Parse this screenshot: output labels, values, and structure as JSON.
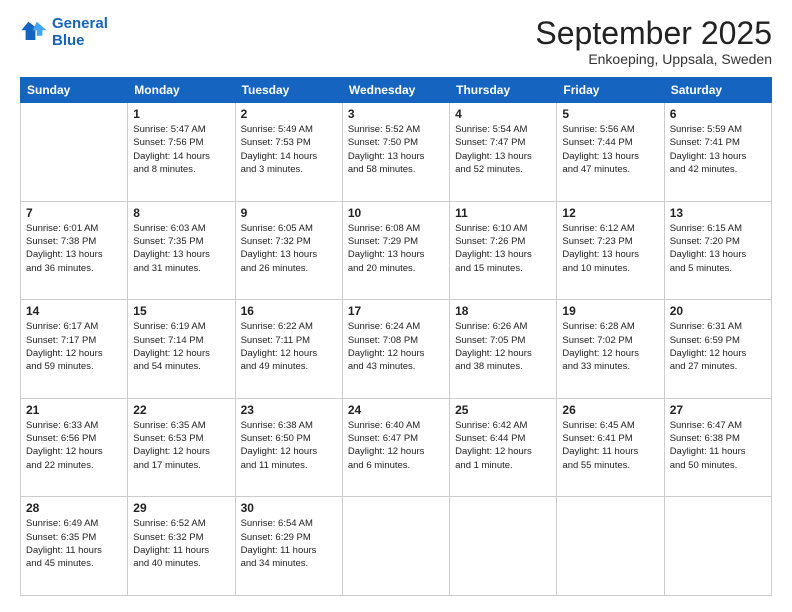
{
  "header": {
    "logo_line1": "General",
    "logo_line2": "Blue",
    "month": "September 2025",
    "location": "Enkoeping, Uppsala, Sweden"
  },
  "days_of_week": [
    "Sunday",
    "Monday",
    "Tuesday",
    "Wednesday",
    "Thursday",
    "Friday",
    "Saturday"
  ],
  "weeks": [
    [
      {
        "day": "",
        "info": ""
      },
      {
        "day": "1",
        "info": "Sunrise: 5:47 AM\nSunset: 7:56 PM\nDaylight: 14 hours\nand 8 minutes."
      },
      {
        "day": "2",
        "info": "Sunrise: 5:49 AM\nSunset: 7:53 PM\nDaylight: 14 hours\nand 3 minutes."
      },
      {
        "day": "3",
        "info": "Sunrise: 5:52 AM\nSunset: 7:50 PM\nDaylight: 13 hours\nand 58 minutes."
      },
      {
        "day": "4",
        "info": "Sunrise: 5:54 AM\nSunset: 7:47 PM\nDaylight: 13 hours\nand 52 minutes."
      },
      {
        "day": "5",
        "info": "Sunrise: 5:56 AM\nSunset: 7:44 PM\nDaylight: 13 hours\nand 47 minutes."
      },
      {
        "day": "6",
        "info": "Sunrise: 5:59 AM\nSunset: 7:41 PM\nDaylight: 13 hours\nand 42 minutes."
      }
    ],
    [
      {
        "day": "7",
        "info": "Sunrise: 6:01 AM\nSunset: 7:38 PM\nDaylight: 13 hours\nand 36 minutes."
      },
      {
        "day": "8",
        "info": "Sunrise: 6:03 AM\nSunset: 7:35 PM\nDaylight: 13 hours\nand 31 minutes."
      },
      {
        "day": "9",
        "info": "Sunrise: 6:05 AM\nSunset: 7:32 PM\nDaylight: 13 hours\nand 26 minutes."
      },
      {
        "day": "10",
        "info": "Sunrise: 6:08 AM\nSunset: 7:29 PM\nDaylight: 13 hours\nand 20 minutes."
      },
      {
        "day": "11",
        "info": "Sunrise: 6:10 AM\nSunset: 7:26 PM\nDaylight: 13 hours\nand 15 minutes."
      },
      {
        "day": "12",
        "info": "Sunrise: 6:12 AM\nSunset: 7:23 PM\nDaylight: 13 hours\nand 10 minutes."
      },
      {
        "day": "13",
        "info": "Sunrise: 6:15 AM\nSunset: 7:20 PM\nDaylight: 13 hours\nand 5 minutes."
      }
    ],
    [
      {
        "day": "14",
        "info": "Sunrise: 6:17 AM\nSunset: 7:17 PM\nDaylight: 12 hours\nand 59 minutes."
      },
      {
        "day": "15",
        "info": "Sunrise: 6:19 AM\nSunset: 7:14 PM\nDaylight: 12 hours\nand 54 minutes."
      },
      {
        "day": "16",
        "info": "Sunrise: 6:22 AM\nSunset: 7:11 PM\nDaylight: 12 hours\nand 49 minutes."
      },
      {
        "day": "17",
        "info": "Sunrise: 6:24 AM\nSunset: 7:08 PM\nDaylight: 12 hours\nand 43 minutes."
      },
      {
        "day": "18",
        "info": "Sunrise: 6:26 AM\nSunset: 7:05 PM\nDaylight: 12 hours\nand 38 minutes."
      },
      {
        "day": "19",
        "info": "Sunrise: 6:28 AM\nSunset: 7:02 PM\nDaylight: 12 hours\nand 33 minutes."
      },
      {
        "day": "20",
        "info": "Sunrise: 6:31 AM\nSunset: 6:59 PM\nDaylight: 12 hours\nand 27 minutes."
      }
    ],
    [
      {
        "day": "21",
        "info": "Sunrise: 6:33 AM\nSunset: 6:56 PM\nDaylight: 12 hours\nand 22 minutes."
      },
      {
        "day": "22",
        "info": "Sunrise: 6:35 AM\nSunset: 6:53 PM\nDaylight: 12 hours\nand 17 minutes."
      },
      {
        "day": "23",
        "info": "Sunrise: 6:38 AM\nSunset: 6:50 PM\nDaylight: 12 hours\nand 11 minutes."
      },
      {
        "day": "24",
        "info": "Sunrise: 6:40 AM\nSunset: 6:47 PM\nDaylight: 12 hours\nand 6 minutes."
      },
      {
        "day": "25",
        "info": "Sunrise: 6:42 AM\nSunset: 6:44 PM\nDaylight: 12 hours\nand 1 minute."
      },
      {
        "day": "26",
        "info": "Sunrise: 6:45 AM\nSunset: 6:41 PM\nDaylight: 11 hours\nand 55 minutes."
      },
      {
        "day": "27",
        "info": "Sunrise: 6:47 AM\nSunset: 6:38 PM\nDaylight: 11 hours\nand 50 minutes."
      }
    ],
    [
      {
        "day": "28",
        "info": "Sunrise: 6:49 AM\nSunset: 6:35 PM\nDaylight: 11 hours\nand 45 minutes."
      },
      {
        "day": "29",
        "info": "Sunrise: 6:52 AM\nSunset: 6:32 PM\nDaylight: 11 hours\nand 40 minutes."
      },
      {
        "day": "30",
        "info": "Sunrise: 6:54 AM\nSunset: 6:29 PM\nDaylight: 11 hours\nand 34 minutes."
      },
      {
        "day": "",
        "info": ""
      },
      {
        "day": "",
        "info": ""
      },
      {
        "day": "",
        "info": ""
      },
      {
        "day": "",
        "info": ""
      }
    ]
  ]
}
